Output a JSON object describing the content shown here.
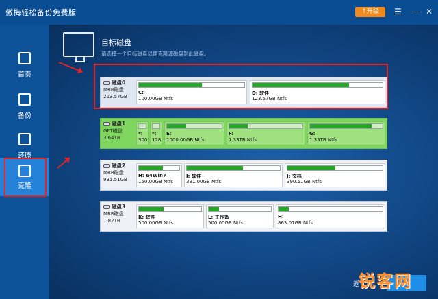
{
  "app": {
    "title": "傲梅轻松备份免费版",
    "upgrade_label": "升级"
  },
  "nav": [
    {
      "label": "首页"
    },
    {
      "label": "备份"
    },
    {
      "label": "还原"
    },
    {
      "label": "克隆"
    }
  ],
  "page": {
    "title": "目标磁盘",
    "subtitle": "请选择一个目标磁盘以便克隆源磁盘到此磁盘。"
  },
  "disks": [
    {
      "name": "磁盘0",
      "type": "MBR磁盘",
      "size": "223.57GB",
      "parts": [
        {
          "label": "C:",
          "size": "100.00GB Ntfs",
          "fill": 0.6
        },
        {
          "label": "D: 软件",
          "size": "123.57GB Ntfs",
          "fill": 0.74
        }
      ]
    },
    {
      "name": "磁盘1",
      "type": "GPT磁盘",
      "size": "3.64TB",
      "parts": [
        {
          "label": "*:",
          "size": "300.",
          "fill": 0.0
        },
        {
          "label": "*:",
          "size": "128.",
          "fill": 0.0
        },
        {
          "label": "E:",
          "size": "1000.00GB Ntfs",
          "fill": 0.35
        },
        {
          "label": "F:",
          "size": "1.33TB Ntfs",
          "fill": 0.25
        },
        {
          "label": "G:",
          "size": "1.33TB Ntfs",
          "fill": 0.85
        }
      ]
    },
    {
      "name": "磁盘2",
      "type": "MBR磁盘",
      "size": "931.51GB",
      "parts": [
        {
          "label": "H: 64Win7",
          "size": "150.00GB Ntfs",
          "fill": 0.6
        },
        {
          "label": "I: 软件",
          "size": "391.00GB Ntfs",
          "fill": 0.6
        },
        {
          "label": "J: 文档",
          "size": "390.51GB Ntfs",
          "fill": 0.5
        }
      ]
    },
    {
      "name": "磁盘3",
      "type": "MBR磁盘",
      "size": "1.82TB",
      "parts": [
        {
          "label": "K: 软件",
          "size": "500.00GB Ntfs",
          "fill": 0.4
        },
        {
          "label": "L: 工作备",
          "size": "500.00GB Ntfs",
          "fill": 0.17
        },
        {
          "label": "H:",
          "size": "863.01GB Ntfs",
          "fill": 0.1
        }
      ]
    }
  ],
  "footer": {
    "next_label": "»",
    "next_prefix": "返",
    "watermark": "锐客网"
  }
}
